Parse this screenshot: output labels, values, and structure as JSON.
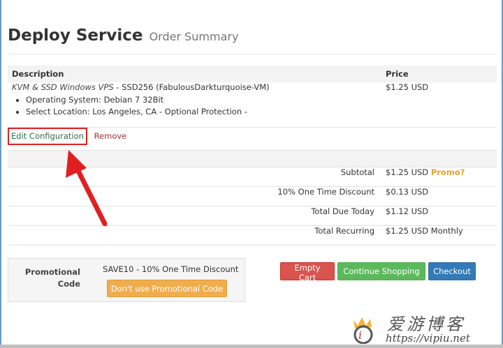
{
  "header": {
    "title": "Deploy Service",
    "subtitle": "Order Summary"
  },
  "cart": {
    "columns": {
      "description": "Description",
      "price": "Price"
    },
    "item": {
      "product": "KVM & SSD Windows VPS",
      "detail": " - SSD256 (FabulousDarkturquoise-VM)",
      "options": [
        "Operating System: Debian 7 32Bit",
        "Select Location: Los Angeles, CA - Optional Protection -"
      ],
      "price": "$1.25 USD"
    },
    "actions": {
      "edit": "Edit Configuration",
      "remove": "Remove"
    }
  },
  "summary": {
    "rows": [
      {
        "label": "Subtotal",
        "value": "$1.25 USD"
      },
      {
        "label": "10% One Time Discount",
        "value": "$0.13 USD"
      },
      {
        "label": "Total Due Today",
        "value": "$1.12 USD"
      },
      {
        "label": "Total Recurring",
        "value": "$1.25 USD Monthly"
      }
    ],
    "promo_link": "Promo?"
  },
  "promo": {
    "label": "Promotional Code",
    "applied": "SAVE10 - 10% One Time Discount",
    "remove_button": "Don't use Promotional Code"
  },
  "buttons": {
    "empty_cart": "Empty Cart",
    "continue_shopping": "Continue Shopping",
    "checkout": "Checkout"
  },
  "watermark": {
    "text": "爱游博客",
    "url": "https://vipiu.net"
  },
  "colors": {
    "highlight_box": "#e02020",
    "arrow": "#e02020",
    "empty_cart": "#d9534f",
    "continue_shopping": "#5cb85c",
    "checkout": "#337ab7",
    "promo_button": "#f0ad4e",
    "promo_link": "#e8a030"
  }
}
